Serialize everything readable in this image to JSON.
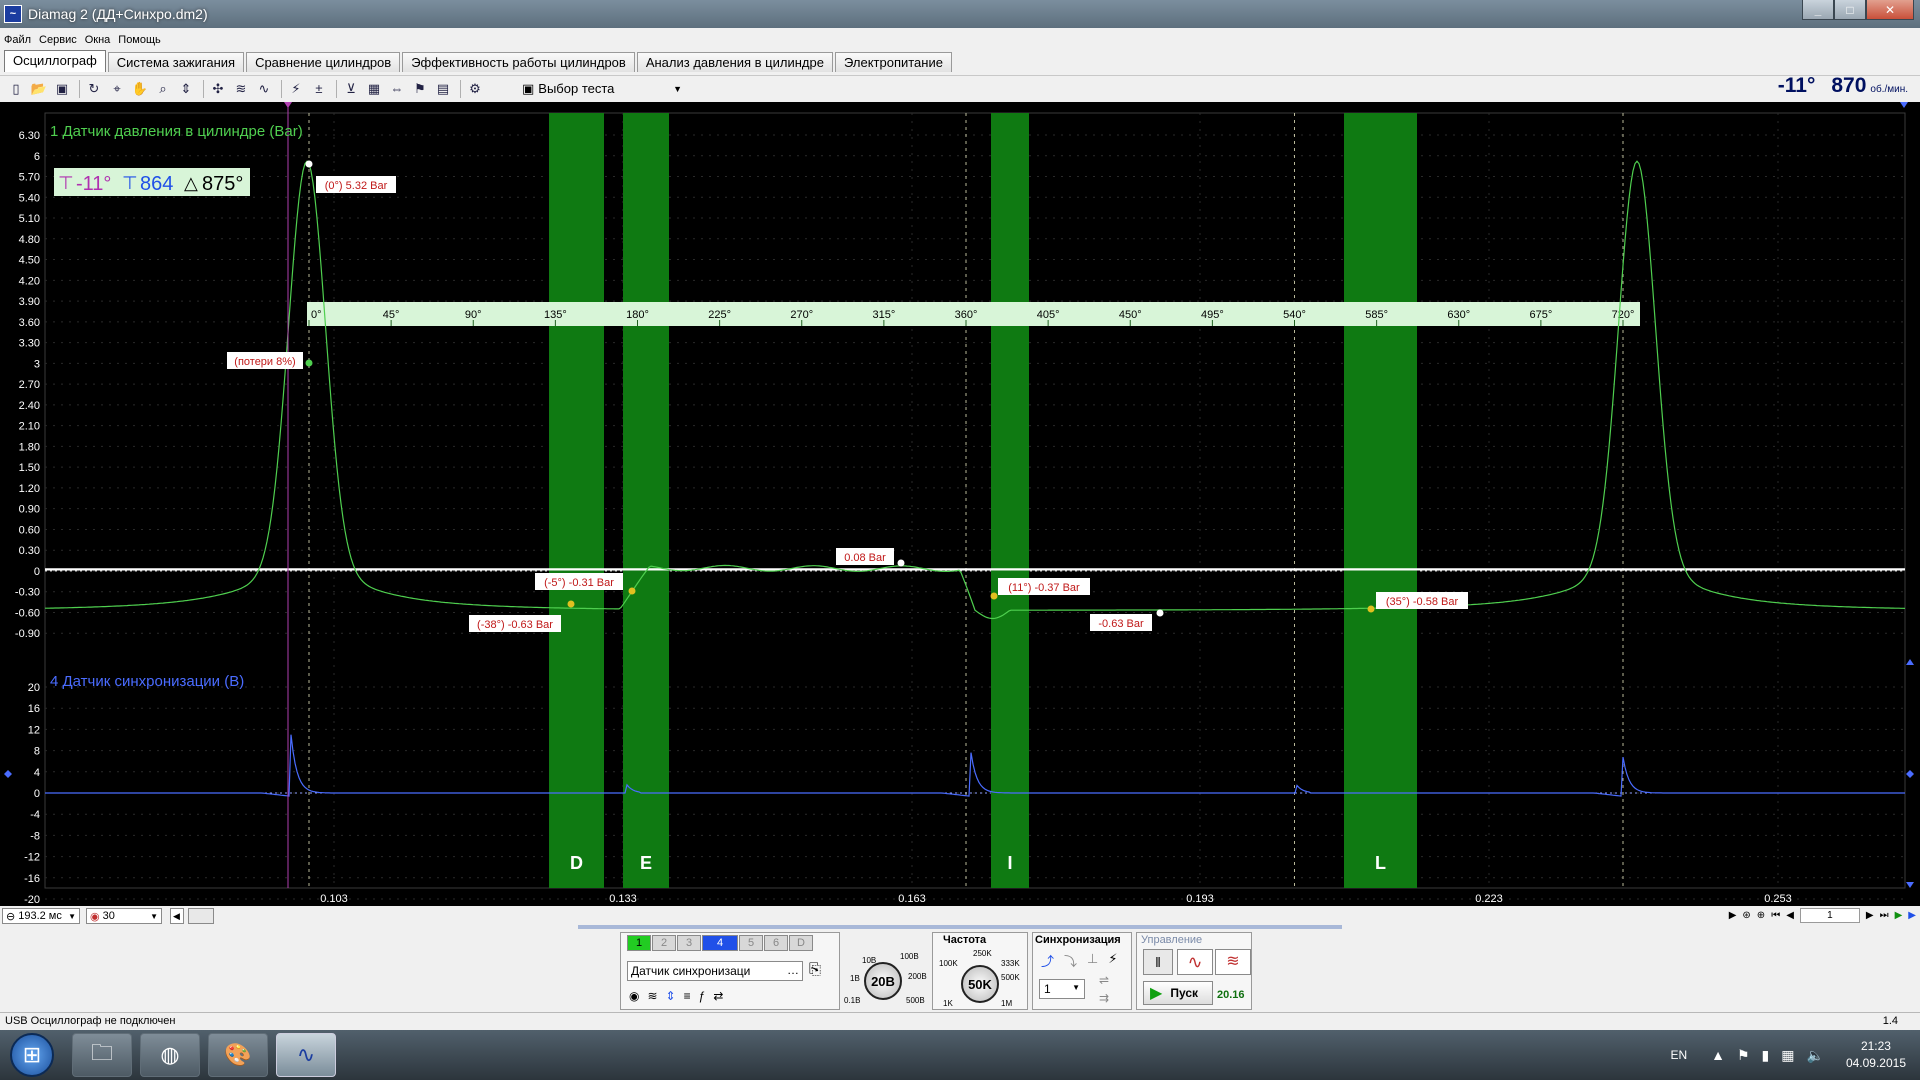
{
  "window": {
    "title": "Diamag 2 (ДД+Синхро.dm2)",
    "app_icon": "diamag-icon"
  },
  "menu": [
    "Файл",
    "Сервис",
    "Окна",
    "Помощь"
  ],
  "tabs": [
    {
      "label": "Осциллограф",
      "active": true
    },
    {
      "label": "Система зажигания",
      "active": false
    },
    {
      "label": "Сравнение цилиндров",
      "active": false
    },
    {
      "label": "Эффективность работы цилиндров",
      "active": false
    },
    {
      "label": "Анализ давления в цилиндре",
      "active": false
    },
    {
      "label": "Электропитание",
      "active": false
    }
  ],
  "toolbar": {
    "test_select": "Выбор теста",
    "icons": [
      "new-file-icon",
      "open-folder-icon",
      "save-icon",
      "rotate-icon",
      "cursor-measure-icon",
      "hand-pan-icon",
      "zoom-icon",
      "autoscale-icon",
      "marker-icon",
      "waves-icon",
      "waves-alt-icon",
      "ignition-icon",
      "zero-icon",
      "filter-icon",
      "table-icon",
      "split-icon",
      "flag-icon",
      "page-icon",
      "auto-icon"
    ]
  },
  "readout": {
    "angle": "-11°",
    "rpm": "870",
    "rpm_unit": "об./мин."
  },
  "channel1": {
    "title": "1 Датчик давления в цилиндре (Bar)",
    "y_ticks": [
      "6.30",
      "6",
      "5.70",
      "5.40",
      "5.10",
      "4.80",
      "4.50",
      "4.20",
      "3.90",
      "3.60",
      "3.30",
      "3",
      "2.70",
      "2.40",
      "2.10",
      "1.80",
      "1.50",
      "1.20",
      "0.90",
      "0.60",
      "0.30",
      "0",
      "-0.30",
      "-0.60",
      "-0.90"
    ],
    "color": "#4fcf4f"
  },
  "channel4": {
    "title": "4 Датчик синхронизации (В)",
    "y_ticks": [
      "20",
      "16",
      "12",
      "8",
      "4",
      "0",
      "-4",
      "-8",
      "-12",
      "-16",
      "-20"
    ],
    "color": "#4a6cff"
  },
  "cursor_box": {
    "v1": "-11°",
    "v2": "864",
    "v3": "875°"
  },
  "degree_scale": [
    "0°",
    "45°",
    "90°",
    "135°",
    "180°",
    "225°",
    "270°",
    "315°",
    "360°",
    "405°",
    "450°",
    "495°",
    "540°",
    "585°",
    "630°",
    "675°",
    "720°"
  ],
  "phase_bands": [
    {
      "label": "D"
    },
    {
      "label": "E"
    },
    {
      "label": "I"
    },
    {
      "label": "L"
    }
  ],
  "annotations": [
    {
      "text": "(0°) 5.32 Bar"
    },
    {
      "text": "(потери 8%)"
    },
    {
      "text": "(-5°) -0.31 Bar"
    },
    {
      "text": "(-38°) -0.63 Bar"
    },
    {
      "text": "0.08 Bar"
    },
    {
      "text": "(11°) -0.37 Bar"
    },
    {
      "text": "-0.63 Bar"
    },
    {
      "text": "(35°) -0.58 Bar"
    }
  ],
  "x_ticks": [
    "0.103",
    "0.133",
    "0.163",
    "0.193",
    "0.223",
    "0.253"
  ],
  "bottom": {
    "timebase": "193.2 мс",
    "trigger": "30",
    "page": "1"
  },
  "control_panel": {
    "channel_buttons": [
      "1",
      "2",
      "3",
      "4",
      "5",
      "6",
      "D"
    ],
    "channel_select": "Датчик синхронизаци",
    "voltage": {
      "value": "20В",
      "labels": [
        "10В",
        "100В",
        "1В",
        "200В",
        "0.1В",
        "500В"
      ]
    },
    "frequency": {
      "title": "Частота",
      "value": "50K",
      "labels": [
        "250K",
        "100K",
        "333K",
        "500K",
        "1K",
        "1M"
      ]
    },
    "sync": {
      "title": "Синхронизация",
      "value": "1"
    },
    "control": {
      "title": "Управление",
      "start": "Пуск",
      "value": "20.16"
    }
  },
  "status": {
    "left": "USB Осциллограф не подключен",
    "right": "1.4"
  },
  "taskbar": {
    "lang": "EN",
    "time": "21:23",
    "date": "04.09.2015"
  }
}
